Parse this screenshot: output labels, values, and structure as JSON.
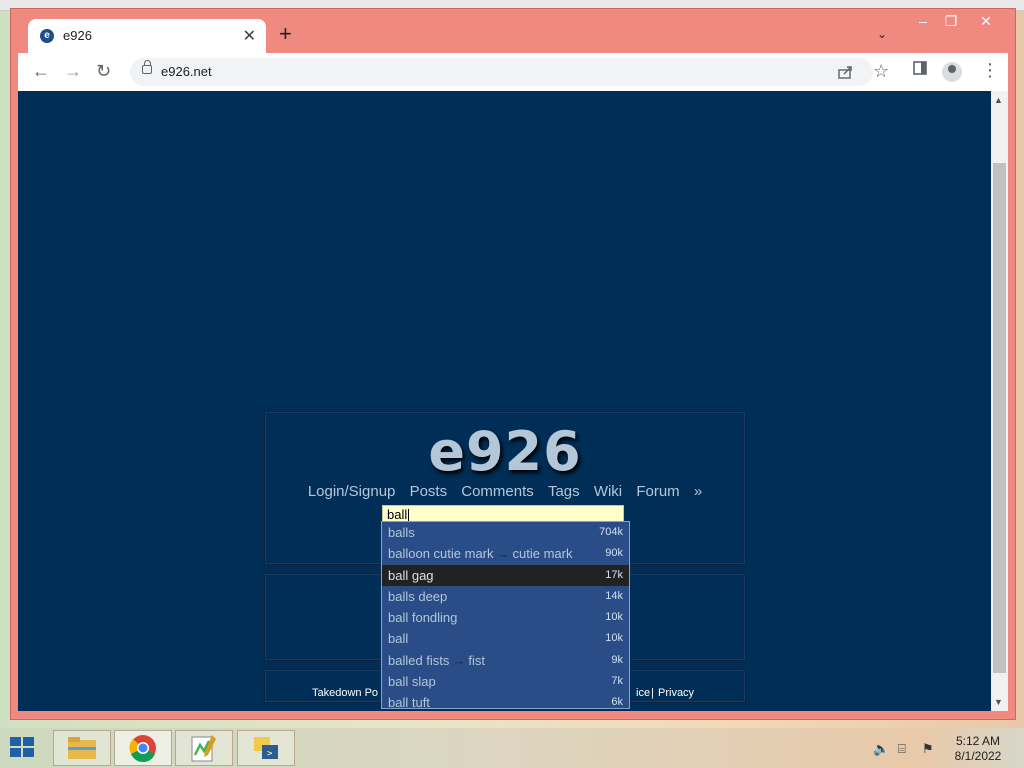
{
  "browser": {
    "tab": {
      "title": "e926",
      "favicon": "e",
      "close": "✕"
    },
    "new_tab": "+",
    "tab_menu": "⌄",
    "window_controls": {
      "minimize": "–",
      "maximize": "❐",
      "close": "✕"
    },
    "nav": {
      "back": "←",
      "forward": "→",
      "reload": "↻"
    },
    "url": "e926.net",
    "icons": {
      "share": "share-icon",
      "bookmark": "☆",
      "sidebar": "▯",
      "menu": "⋮"
    }
  },
  "page": {
    "logo": "e926",
    "nav_links": [
      "Login/Signup",
      "Posts",
      "Comments",
      "Tags",
      "Wiki",
      "Forum",
      "»"
    ],
    "search_value": "ball",
    "footer_left": "Takedown Po",
    "footer_right_partial": "ice",
    "footer_sep": "|",
    "footer_privacy": "Privacy",
    "autocomplete": [
      {
        "tag": "balls",
        "count": "704k"
      },
      {
        "tag": "balloon cutie mark",
        "alias": "cutie mark",
        "count": "90k"
      },
      {
        "tag": "ball gag",
        "count": "17k",
        "selected": true
      },
      {
        "tag": "balls deep",
        "count": "14k"
      },
      {
        "tag": "ball fondling",
        "count": "10k"
      },
      {
        "tag": "ball",
        "count": "10k"
      },
      {
        "tag": "balled fists",
        "alias": "fist",
        "count": "9k"
      },
      {
        "tag": "ball slap",
        "count": "7k"
      },
      {
        "tag": "ball tuft",
        "count": "6k"
      }
    ],
    "colors": {
      "background": "#012e57",
      "link": "#b4c7d9",
      "search_bg": "#ffffcc",
      "dropdown_bg": "#2a4d87"
    }
  },
  "taskbar": {
    "apps": [
      "file-explorer-icon",
      "chrome-icon",
      "notepad-plus-plus-icon",
      "python-icon"
    ],
    "clock_time": "5:12 AM",
    "clock_date": "8/1/2022"
  }
}
